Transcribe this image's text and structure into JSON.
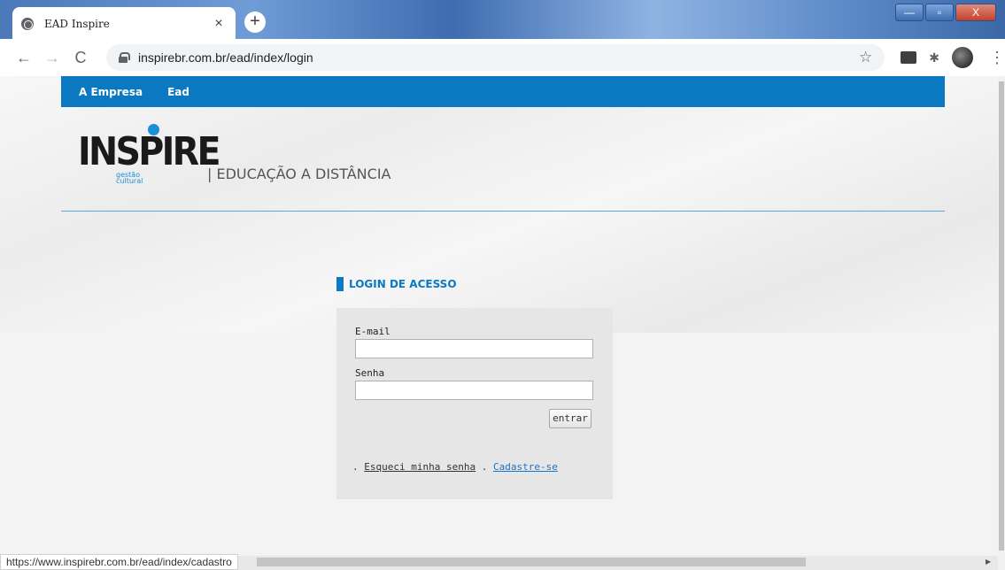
{
  "browser": {
    "tab_title": "EAD Inspire",
    "tab_close": "×",
    "new_tab": "+",
    "url": "inspirebr.com.br/ead/index/login",
    "back": "←",
    "forward": "→",
    "reload": "C",
    "star": "☆",
    "puzzle": "✱",
    "menu": "⋮",
    "window_buttons": {
      "minimize": "—",
      "maximize": "▫",
      "close": "X"
    }
  },
  "site_nav": {
    "items": [
      {
        "label": "A Empresa"
      },
      {
        "label": "Ead"
      }
    ]
  },
  "header": {
    "logo_text": "INSPIRE",
    "logo_sub_1": "gestão",
    "logo_sub_2": "cultural",
    "tagline": "| EDUCAÇÃO A DISTÂNCIA"
  },
  "login": {
    "title": "LOGIN DE ACESSO",
    "email_label": "E-mail",
    "email_value": "",
    "password_label": "Senha",
    "password_value": "",
    "submit_label": "entrar",
    "sep1": ". ",
    "forgot_link": "Esqueci minha senha",
    "sep2": " . ",
    "signup_link": "Cadastre-se"
  },
  "status_bar": {
    "text": "https://www.inspirebr.com.br/ead/index/cadastro"
  },
  "colors": {
    "brand_blue": "#0a79c2",
    "link_blue": "#1a73c8"
  }
}
